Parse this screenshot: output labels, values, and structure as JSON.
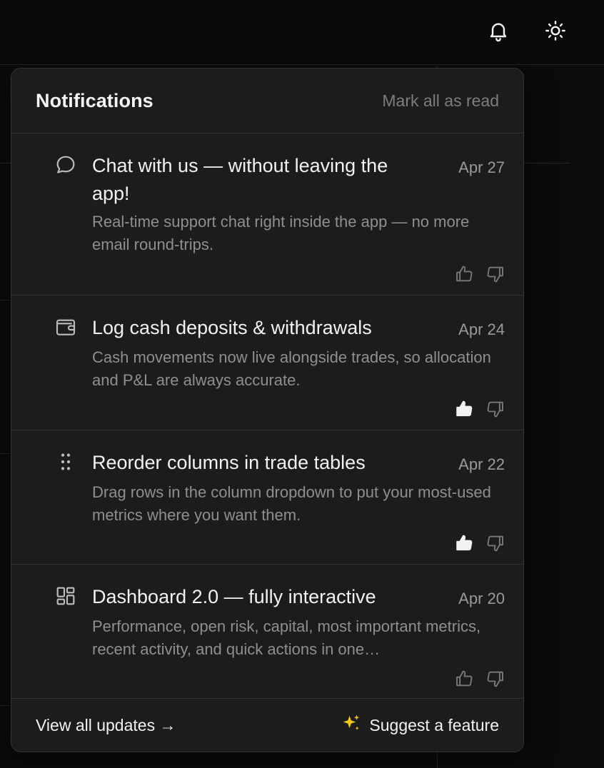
{
  "header": {
    "icons": [
      "bell-icon",
      "sun-icon"
    ]
  },
  "notifications": {
    "title": "Notifications",
    "mark_all_label": "Mark all as read",
    "items": [
      {
        "icon": "chat-bubble-icon",
        "title": "Chat with us — without leaving the app!",
        "date": "Apr 27",
        "description": "Real-time support chat right inside the app — no more email round-trips.",
        "liked": false
      },
      {
        "icon": "wallet-icon",
        "title": "Log cash deposits & withdrawals",
        "date": "Apr 24",
        "description": "Cash movements now live alongside trades, so allocation and P&L are always accurate.",
        "liked": true
      },
      {
        "icon": "drag-handle-icon",
        "title": "Reorder columns in trade tables",
        "date": "Apr 22",
        "description": "Drag rows in the column dropdown to put your most-used metrics where you want them.",
        "liked": true
      },
      {
        "icon": "dashboard-grid-icon",
        "title": "Dashboard 2.0 — fully interactive",
        "date": "Apr 20",
        "description": "Performance, open risk, capital, most important metrics, recent activity, and quick actions in one…",
        "liked": false
      }
    ],
    "footer": {
      "view_all_label": "View all updates →",
      "suggest_icon": "sparkles-icon",
      "suggest_label": "Suggest a feature"
    }
  },
  "colors": {
    "background": "#0b0b0b",
    "panel": "#1c1c1c",
    "border": "#333333",
    "text": "#f2f2f2",
    "muted": "#8f8f8f",
    "sparkle": "#f5c518"
  }
}
